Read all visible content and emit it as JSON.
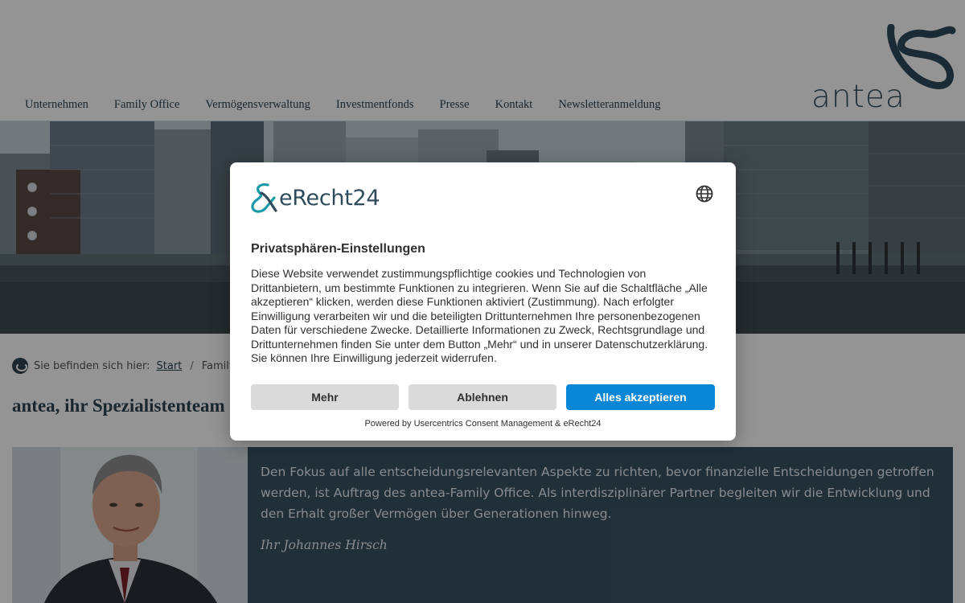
{
  "header": {
    "nav": [
      "Unternehmen",
      "Family Office",
      "Vermögensverwaltung",
      "Investmentfonds",
      "Presse",
      "Kontakt",
      "Newsletteranmeldung"
    ],
    "logo_text": "antea"
  },
  "breadcrumb": {
    "prefix": "Sie befinden sich hier:",
    "items": [
      "Start",
      "Family Office"
    ],
    "separator": "/"
  },
  "page_title": "antea, ihr Spezialistenteam",
  "intro": {
    "text": "Den Fokus auf alle entscheidungsrelevanten Aspekte zu richten, bevor finanzielle Entscheidungen getroffen werden, ist Auftrag des antea-Family Office. Als interdisziplinärer Partner begleiten wir die Entwicklung und den Erhalt großer Vermögen über Generationen hinweg.",
    "signature": "Ihr Johannes Hirsch"
  },
  "consent": {
    "brand": "eRecht24",
    "language_icon": "globe-icon",
    "title": "Privatsphären-Einstellungen",
    "body": "Diese Website verwendet zustimmungspflichtige cookies und Technologien von Drittanbietern, um bestimmte Funktionen zu integrieren. Wenn Sie auf die Schaltfläche „Alle akzeptieren“ klicken, werden diese Funktionen aktiviert (Zustimmung). Nach erfolgter Einwilligung verarbeiten wir und die beteiligten Drittunternehmen Ihre personenbezogenen Daten für verschiedene Zwecke. Detaillierte Informationen zu Zweck, Rechtsgrundlage und Drittunternehmen finden Sie unter dem Button „Mehr“ und in unserer Datenschutzerklärung. Sie können Ihre Einwilligung jederzeit widerrufen.",
    "buttons": {
      "more": "Mehr",
      "deny": "Ablehnen",
      "accept": "Alles akzeptieren"
    },
    "powered_by": "Powered by Usercentrics Consent Management & eRecht24",
    "accent_color": "#0a86d6"
  },
  "colors": {
    "brand_dark": "#2f4451",
    "intro_box": "#3a5262"
  }
}
